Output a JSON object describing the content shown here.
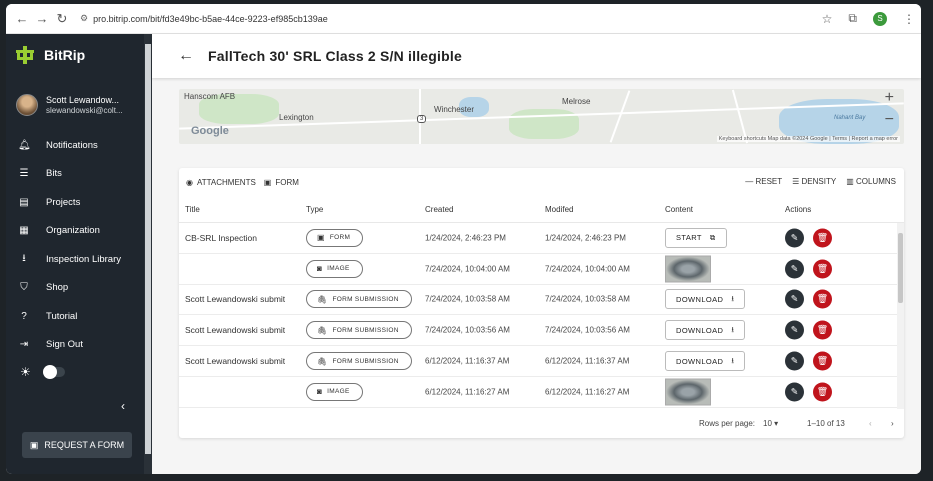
{
  "browser": {
    "url": "pro.bitrip.com/bit/fd3e49bc-b5ae-44ce-9223-ef985cb139ae",
    "profile_initial": "S"
  },
  "sidebar": {
    "app_name": "BitRip",
    "user": {
      "name": "Scott Lewandow...",
      "email": "slewandowski@colt..."
    },
    "items": [
      {
        "label": "Notifications",
        "icon": "bell-icon"
      },
      {
        "label": "Bits",
        "icon": "list-icon"
      },
      {
        "label": "Projects",
        "icon": "clipboard-icon"
      },
      {
        "label": "Organization",
        "icon": "building-icon"
      },
      {
        "label": "Inspection Library",
        "icon": "download-icon"
      },
      {
        "label": "Shop",
        "icon": "shopping-bag-icon"
      },
      {
        "label": "Tutorial",
        "icon": "help-icon"
      },
      {
        "label": "Sign Out",
        "icon": "sign-out-icon"
      }
    ],
    "request_form_label": "REQUEST A FORM"
  },
  "page": {
    "title": "FallTech 30' SRL Class 2 S/N illegible"
  },
  "map": {
    "labels": {
      "hanscom": "Hanscom AFB",
      "lexington": "Lexington",
      "winchester": "Winchester",
      "melrose": "Melrose",
      "nahant": "Nahant Bay",
      "route": "3"
    },
    "google_logo": "Google",
    "attribution": "Keyboard shortcuts   Map data ©2024 Google | Terms | Report a map error"
  },
  "toolbar": {
    "attachments_label": "ATTACHMENTS",
    "form_label": "FORM",
    "reset_label": "RESET",
    "density_label": "DENSITY",
    "columns_label": "COLUMNS"
  },
  "table": {
    "headers": {
      "title": "Title",
      "type": "Type",
      "created": "Created",
      "modified": "Modifed",
      "content": "Content",
      "actions": "Actions"
    },
    "rows": [
      {
        "title": "CB-SRL Inspection",
        "type": "FORM",
        "type_icon": "form-icon",
        "created": "1/24/2024, 2:46:23 PM",
        "modified": "1/24/2024, 2:46:23 PM",
        "content_kind": "button",
        "content_label": "START",
        "content_icon": "external-link-icon"
      },
      {
        "title": "",
        "type": "IMAGE",
        "type_icon": "camera-icon",
        "created": "7/24/2024, 10:04:00 AM",
        "modified": "7/24/2024, 10:04:00 AM",
        "content_kind": "image"
      },
      {
        "title": "Scott Lewandowski submit",
        "type": "FORM SUBMISSION",
        "type_icon": "paperclip-icon",
        "created": "7/24/2024, 10:03:58 AM",
        "modified": "7/24/2024, 10:03:58 AM",
        "content_kind": "button",
        "content_label": "DOWNLOAD",
        "content_icon": "download-icon"
      },
      {
        "title": "Scott Lewandowski submit",
        "type": "FORM SUBMISSION",
        "type_icon": "paperclip-icon",
        "created": "7/24/2024, 10:03:56 AM",
        "modified": "7/24/2024, 10:03:56 AM",
        "content_kind": "button",
        "content_label": "DOWNLOAD",
        "content_icon": "download-icon"
      },
      {
        "title": "Scott Lewandowski submit",
        "type": "FORM SUBMISSION",
        "type_icon": "paperclip-icon",
        "created": "6/12/2024, 11:16:37 AM",
        "modified": "6/12/2024, 11:16:37 AM",
        "content_kind": "button",
        "content_label": "DOWNLOAD",
        "content_icon": "download-icon"
      },
      {
        "title": "",
        "type": "IMAGE",
        "type_icon": "camera-icon",
        "created": "6/12/2024, 11:16:27 AM",
        "modified": "6/12/2024, 11:16:27 AM",
        "content_kind": "image"
      }
    ]
  },
  "pagination": {
    "rows_per_page_label": "Rows per page:",
    "rows_per_page": "10",
    "range": "1–10 of 13"
  },
  "colors": {
    "sidebar_bg": "#1f262e",
    "delete_red": "#c0141c",
    "edit_dark": "#2b3238",
    "logo_green": "#9acd32"
  }
}
